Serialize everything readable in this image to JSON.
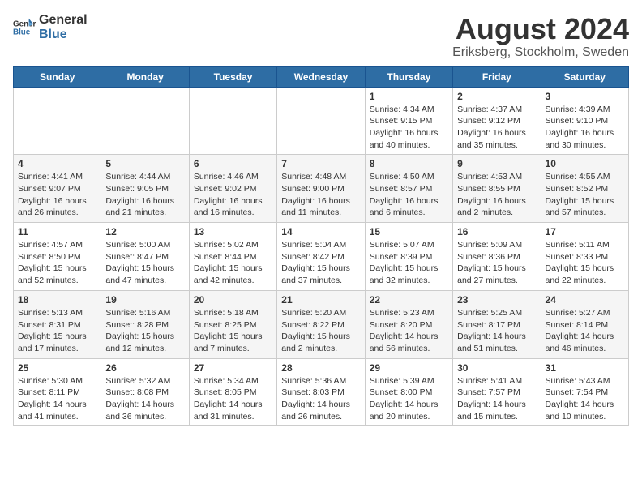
{
  "header": {
    "logo_general": "General",
    "logo_blue": "Blue",
    "month": "August 2024",
    "location": "Eriksberg, Stockholm, Sweden"
  },
  "days_of_week": [
    "Sunday",
    "Monday",
    "Tuesday",
    "Wednesday",
    "Thursday",
    "Friday",
    "Saturday"
  ],
  "weeks": [
    [
      {
        "day": "",
        "info": ""
      },
      {
        "day": "",
        "info": ""
      },
      {
        "day": "",
        "info": ""
      },
      {
        "day": "",
        "info": ""
      },
      {
        "day": "1",
        "info": "Sunrise: 4:34 AM\nSunset: 9:15 PM\nDaylight: 16 hours\nand 40 minutes."
      },
      {
        "day": "2",
        "info": "Sunrise: 4:37 AM\nSunset: 9:12 PM\nDaylight: 16 hours\nand 35 minutes."
      },
      {
        "day": "3",
        "info": "Sunrise: 4:39 AM\nSunset: 9:10 PM\nDaylight: 16 hours\nand 30 minutes."
      }
    ],
    [
      {
        "day": "4",
        "info": "Sunrise: 4:41 AM\nSunset: 9:07 PM\nDaylight: 16 hours\nand 26 minutes."
      },
      {
        "day": "5",
        "info": "Sunrise: 4:44 AM\nSunset: 9:05 PM\nDaylight: 16 hours\nand 21 minutes."
      },
      {
        "day": "6",
        "info": "Sunrise: 4:46 AM\nSunset: 9:02 PM\nDaylight: 16 hours\nand 16 minutes."
      },
      {
        "day": "7",
        "info": "Sunrise: 4:48 AM\nSunset: 9:00 PM\nDaylight: 16 hours\nand 11 minutes."
      },
      {
        "day": "8",
        "info": "Sunrise: 4:50 AM\nSunset: 8:57 PM\nDaylight: 16 hours\nand 6 minutes."
      },
      {
        "day": "9",
        "info": "Sunrise: 4:53 AM\nSunset: 8:55 PM\nDaylight: 16 hours\nand 2 minutes."
      },
      {
        "day": "10",
        "info": "Sunrise: 4:55 AM\nSunset: 8:52 PM\nDaylight: 15 hours\nand 57 minutes."
      }
    ],
    [
      {
        "day": "11",
        "info": "Sunrise: 4:57 AM\nSunset: 8:50 PM\nDaylight: 15 hours\nand 52 minutes."
      },
      {
        "day": "12",
        "info": "Sunrise: 5:00 AM\nSunset: 8:47 PM\nDaylight: 15 hours\nand 47 minutes."
      },
      {
        "day": "13",
        "info": "Sunrise: 5:02 AM\nSunset: 8:44 PM\nDaylight: 15 hours\nand 42 minutes."
      },
      {
        "day": "14",
        "info": "Sunrise: 5:04 AM\nSunset: 8:42 PM\nDaylight: 15 hours\nand 37 minutes."
      },
      {
        "day": "15",
        "info": "Sunrise: 5:07 AM\nSunset: 8:39 PM\nDaylight: 15 hours\nand 32 minutes."
      },
      {
        "day": "16",
        "info": "Sunrise: 5:09 AM\nSunset: 8:36 PM\nDaylight: 15 hours\nand 27 minutes."
      },
      {
        "day": "17",
        "info": "Sunrise: 5:11 AM\nSunset: 8:33 PM\nDaylight: 15 hours\nand 22 minutes."
      }
    ],
    [
      {
        "day": "18",
        "info": "Sunrise: 5:13 AM\nSunset: 8:31 PM\nDaylight: 15 hours\nand 17 minutes."
      },
      {
        "day": "19",
        "info": "Sunrise: 5:16 AM\nSunset: 8:28 PM\nDaylight: 15 hours\nand 12 minutes."
      },
      {
        "day": "20",
        "info": "Sunrise: 5:18 AM\nSunset: 8:25 PM\nDaylight: 15 hours\nand 7 minutes."
      },
      {
        "day": "21",
        "info": "Sunrise: 5:20 AM\nSunset: 8:22 PM\nDaylight: 15 hours\nand 2 minutes."
      },
      {
        "day": "22",
        "info": "Sunrise: 5:23 AM\nSunset: 8:20 PM\nDaylight: 14 hours\nand 56 minutes."
      },
      {
        "day": "23",
        "info": "Sunrise: 5:25 AM\nSunset: 8:17 PM\nDaylight: 14 hours\nand 51 minutes."
      },
      {
        "day": "24",
        "info": "Sunrise: 5:27 AM\nSunset: 8:14 PM\nDaylight: 14 hours\nand 46 minutes."
      }
    ],
    [
      {
        "day": "25",
        "info": "Sunrise: 5:30 AM\nSunset: 8:11 PM\nDaylight: 14 hours\nand 41 minutes."
      },
      {
        "day": "26",
        "info": "Sunrise: 5:32 AM\nSunset: 8:08 PM\nDaylight: 14 hours\nand 36 minutes."
      },
      {
        "day": "27",
        "info": "Sunrise: 5:34 AM\nSunset: 8:05 PM\nDaylight: 14 hours\nand 31 minutes."
      },
      {
        "day": "28",
        "info": "Sunrise: 5:36 AM\nSunset: 8:03 PM\nDaylight: 14 hours\nand 26 minutes."
      },
      {
        "day": "29",
        "info": "Sunrise: 5:39 AM\nSunset: 8:00 PM\nDaylight: 14 hours\nand 20 minutes."
      },
      {
        "day": "30",
        "info": "Sunrise: 5:41 AM\nSunset: 7:57 PM\nDaylight: 14 hours\nand 15 minutes."
      },
      {
        "day": "31",
        "info": "Sunrise: 5:43 AM\nSunset: 7:54 PM\nDaylight: 14 hours\nand 10 minutes."
      }
    ]
  ]
}
